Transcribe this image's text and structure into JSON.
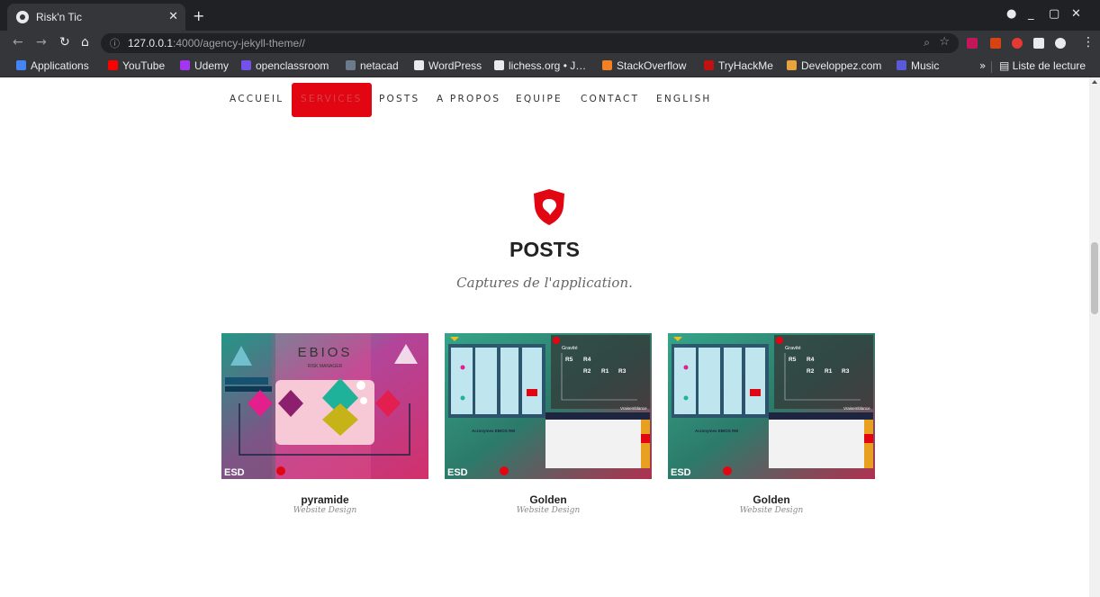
{
  "browser": {
    "tab_title": "Risk'n Tic",
    "new_tab_symbol": "+",
    "url_host": "127.0.0.1",
    "url_rest": ":4000/agency-jekyll-theme//",
    "reading_list_label": "Liste de lecture",
    "bookmarks": [
      {
        "label": "Applications",
        "color": "#4285f4"
      },
      {
        "label": "YouTube",
        "color": "#ff0000"
      },
      {
        "label": "Udemy",
        "color": "#a435f0"
      },
      {
        "label": "openclassroom",
        "color": "#7451eb"
      },
      {
        "label": "netacad",
        "color": "#6b7b8c"
      },
      {
        "label": "WordPress",
        "color": "#e8eaed"
      },
      {
        "label": "lichess.org • J…",
        "color": "#e8eaed"
      },
      {
        "label": "StackOverflow",
        "color": "#f48024"
      },
      {
        "label": "TryHackMe",
        "color": "#c11111"
      },
      {
        "label": "Developpez.com",
        "color": "#e8a33d"
      },
      {
        "label": "Music",
        "color": "#5a5ad9"
      }
    ]
  },
  "site": {
    "nav": [
      {
        "label": "ACCUEIL"
      },
      {
        "label": "SERVICES",
        "active": true
      },
      {
        "label": "POSTS"
      },
      {
        "label": "A PROPOS"
      },
      {
        "label": "EQUIPE"
      },
      {
        "label": "CONTACT"
      },
      {
        "label": "ENGLISH"
      }
    ],
    "accent_color": "#e20613",
    "section": {
      "title": "POSTS",
      "subtitle": "Captures de l'application."
    },
    "posts": [
      {
        "title": "pyramide",
        "category": "Website Design",
        "thumb_heading": "EBIOS",
        "thumb_subheading": "RISK MANAGER",
        "brand": "ESD"
      },
      {
        "title": "Golden",
        "category": "Website Design",
        "brand": "ESD",
        "matrix_title": "Gravité",
        "matrix_xlabel": "Vraisemblance",
        "panel_title": "Acronymes EBIOS RM",
        "risks": [
          "R5",
          "R4",
          "R2",
          "R1",
          "R3"
        ]
      },
      {
        "title": "Golden",
        "category": "Website Design",
        "brand": "ESD",
        "matrix_title": "Gravité",
        "matrix_xlabel": "Vraisemblance",
        "panel_title": "Acronymes EBIOS RM",
        "risks": [
          "R5",
          "R4",
          "R2",
          "R1",
          "R3"
        ]
      }
    ]
  }
}
